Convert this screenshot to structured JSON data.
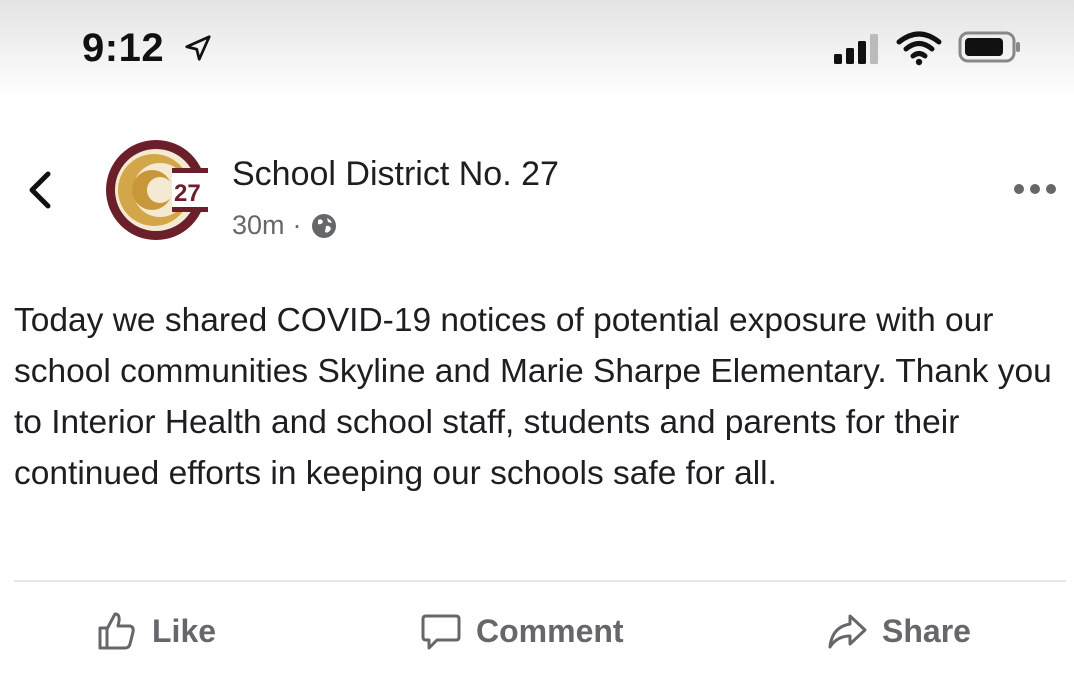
{
  "status_bar": {
    "time": "9:12",
    "icons": [
      "location-arrow-icon",
      "cellular-signal-icon",
      "wifi-icon",
      "battery-icon"
    ]
  },
  "post": {
    "author": "School District No. 27",
    "timestamp": "30m",
    "separator": "·",
    "audience_icon": "globe-icon",
    "text": "Today we shared COVID-19 notices of potential exposure with our school communities Skyline and Marie Sharpe Elementary. Thank you to Interior Health and school staff, students and parents for their continued efforts in keeping our schools safe for all.",
    "avatar_text": "27"
  },
  "actions": {
    "like": "Like",
    "comment": "Comment",
    "share": "Share"
  },
  "colors": {
    "logo_maroon": "#6b1f2a",
    "logo_gold": "#d4a64a",
    "secondary_text": "#65676b",
    "primary_text": "#1c1e21"
  }
}
